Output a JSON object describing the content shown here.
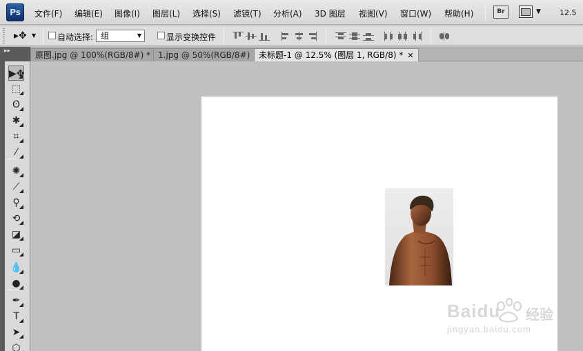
{
  "app": {
    "logo_text": "Ps",
    "bridge_badge": "Br",
    "zoom_level": "12.5"
  },
  "menu": {
    "items": [
      "文件(F)",
      "编辑(E)",
      "图像(I)",
      "图层(L)",
      "选择(S)",
      "滤镜(T)",
      "分析(A)",
      "3D 图层",
      "视图(V)",
      "窗口(W)",
      "帮助(H)"
    ]
  },
  "options": {
    "auto_select_label": "自动选择:",
    "auto_select_checked": false,
    "auto_select_value": "组",
    "show_transform_label": "显示变换控件",
    "show_transform_checked": false
  },
  "tabs": [
    {
      "label": "原图.jpg @ 100%(RGB/8#) *",
      "close": "✕",
      "active": false
    },
    {
      "label": "1.jpg @ 50%(RGB/8#)",
      "close": "✕",
      "active": false
    },
    {
      "label": "未标题-1 @ 12.5% (图层 1, RGB/8) *",
      "close": "✕",
      "active": true
    }
  ],
  "panel_toggle": "▸▸",
  "tools": [
    {
      "name": "move-tool",
      "glyph": "▶✥",
      "selected": true
    },
    {
      "name": "marquee-tool",
      "glyph": "⬚"
    },
    {
      "name": "lasso-tool",
      "glyph": "ʘ"
    },
    {
      "name": "magic-wand-tool",
      "glyph": "✱"
    },
    {
      "name": "crop-tool",
      "glyph": "⌗"
    },
    {
      "name": "eyedropper-tool",
      "glyph": "⁄"
    },
    {
      "name": "spot-healing-tool",
      "glyph": "✺"
    },
    {
      "name": "brush-tool",
      "glyph": "⟋"
    },
    {
      "name": "clone-stamp-tool",
      "glyph": "⚲"
    },
    {
      "name": "history-brush-tool",
      "glyph": "⟲"
    },
    {
      "name": "eraser-tool",
      "glyph": "◪"
    },
    {
      "name": "gradient-tool",
      "glyph": "▭"
    },
    {
      "name": "blur-tool",
      "glyph": "💧"
    },
    {
      "name": "dodge-tool",
      "glyph": "●"
    },
    {
      "name": "pen-tool",
      "glyph": "✒"
    },
    {
      "name": "type-tool",
      "glyph": "T"
    },
    {
      "name": "path-selection-tool",
      "glyph": "➤"
    },
    {
      "name": "shape-tool",
      "glyph": "⬡"
    }
  ],
  "watermark": {
    "brand": "Baidu",
    "brand_cn": "经验",
    "url": "jingyan.baidu.com"
  },
  "colors": {
    "canvas_bg": "#c0c0c0",
    "document_bg": "#ffffff",
    "ps_logo": "#1f4a8a"
  }
}
